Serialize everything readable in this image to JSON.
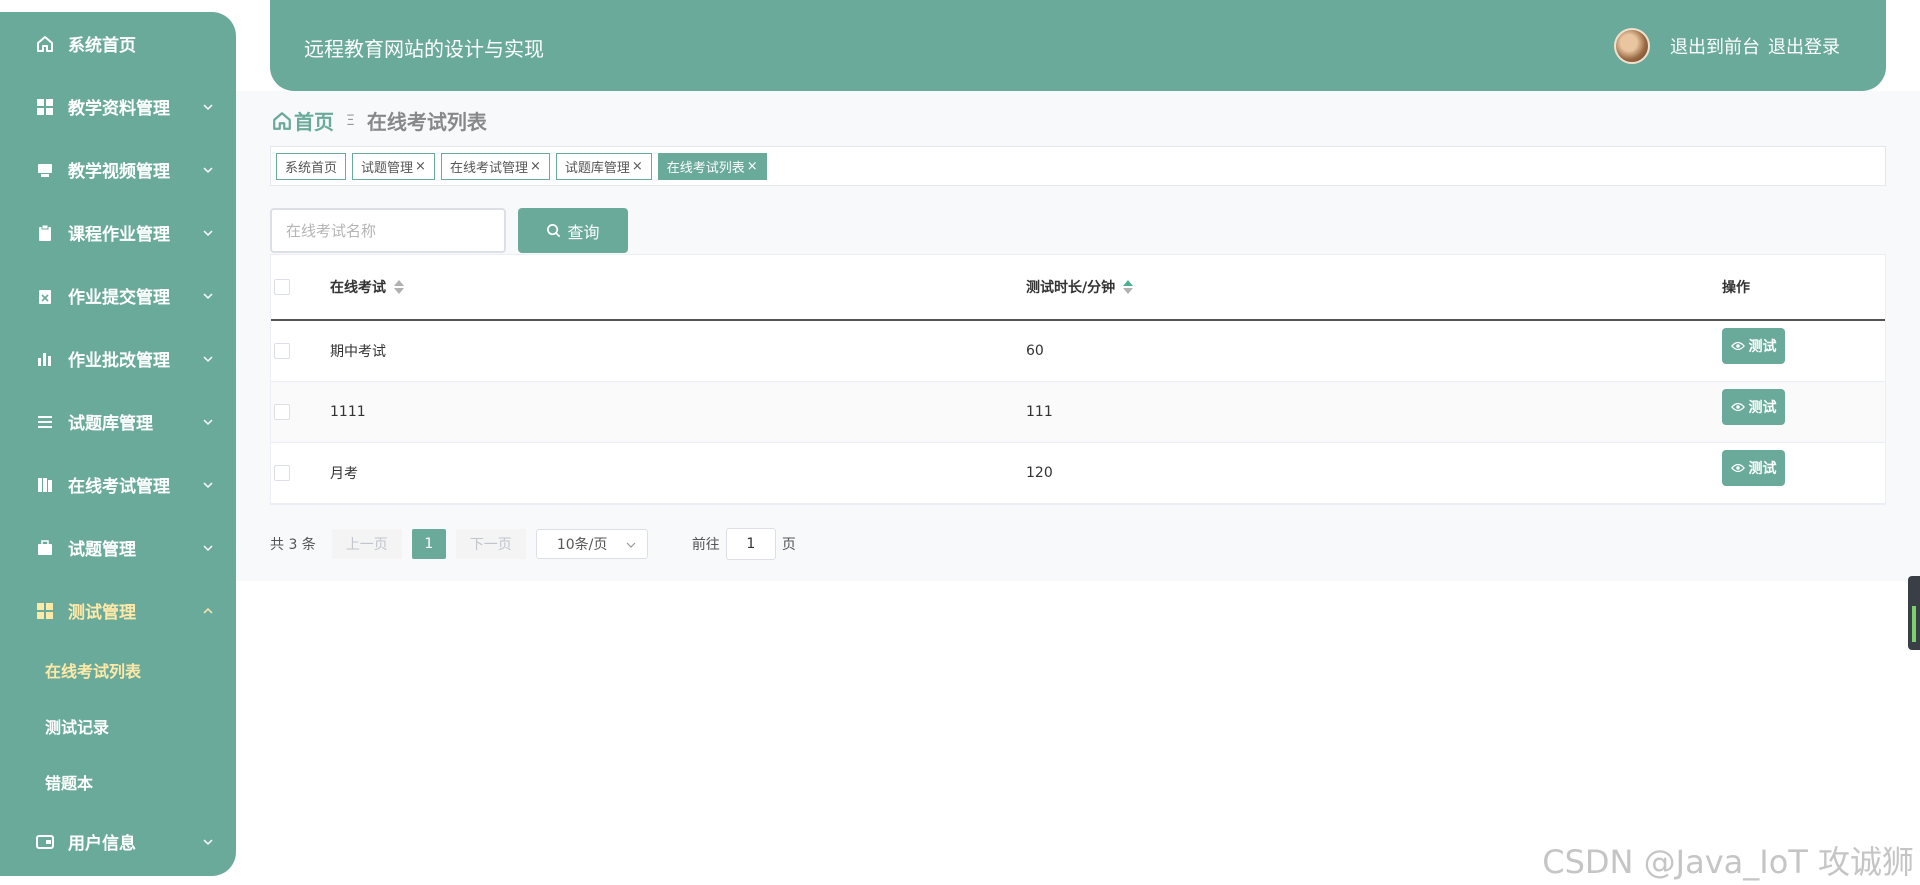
{
  "sidebar": {
    "items": [
      {
        "label": "系统首页",
        "icon": "home-icon"
      },
      {
        "label": "教学资料管理",
        "icon": "grid-icon"
      },
      {
        "label": "教学视频管理",
        "icon": "monitor-icon"
      },
      {
        "label": "课程作业管理",
        "icon": "clipboard-icon"
      },
      {
        "label": "作业提交管理",
        "icon": "clipboard-x-icon"
      },
      {
        "label": "作业批改管理",
        "icon": "bar-chart-icon"
      },
      {
        "label": "试题库管理",
        "icon": "list-icon"
      },
      {
        "label": "在线考试管理",
        "icon": "book-icon"
      },
      {
        "label": "试题管理",
        "icon": "briefcase-icon"
      },
      {
        "label": "测试管理",
        "icon": "grid-icon"
      }
    ],
    "sub_items": [
      {
        "label": "在线考试列表"
      },
      {
        "label": "测试记录"
      },
      {
        "label": "错题本"
      }
    ],
    "user_info": {
      "label": "用户信息",
      "icon": "card-icon"
    },
    "active_color": "#ffe9a8"
  },
  "header": {
    "title": "远程教育网站的设计与实现",
    "front_link": "退出到前台",
    "logout_link": "退出登录"
  },
  "breadcrumb": {
    "home": "首页",
    "separator": "Ξ",
    "current": "在线考试列表"
  },
  "tags": [
    {
      "label": "系统首页",
      "closable": false
    },
    {
      "label": "试题管理",
      "closable": true
    },
    {
      "label": "在线考试管理",
      "closable": true
    },
    {
      "label": "试题库管理",
      "closable": true
    },
    {
      "label": "在线考试列表",
      "closable": true,
      "active": true
    }
  ],
  "tag_close": "×",
  "search": {
    "placeholder": "在线考试名称",
    "button_label": "查询"
  },
  "table": {
    "headers": {
      "name": "在线考试",
      "duration": "测试时长/分钟",
      "operation": "操作"
    },
    "rows": [
      {
        "name": "期中考试",
        "duration": "60"
      },
      {
        "name": "1111",
        "duration": "111"
      },
      {
        "name": "月考",
        "duration": "120"
      }
    ],
    "action_label": "测试"
  },
  "pagination": {
    "total": "共 3 条",
    "prev": "上一页",
    "current_page": "1",
    "next": "下一页",
    "page_size": "10条/页",
    "goto_label": "前往",
    "goto_value": "1",
    "page_suffix": "页"
  },
  "watermark": "CSDN @Java_IoT 攻诚狮",
  "colors": {
    "primary": "#6aaa9a",
    "accent": "#ffe9a8"
  }
}
